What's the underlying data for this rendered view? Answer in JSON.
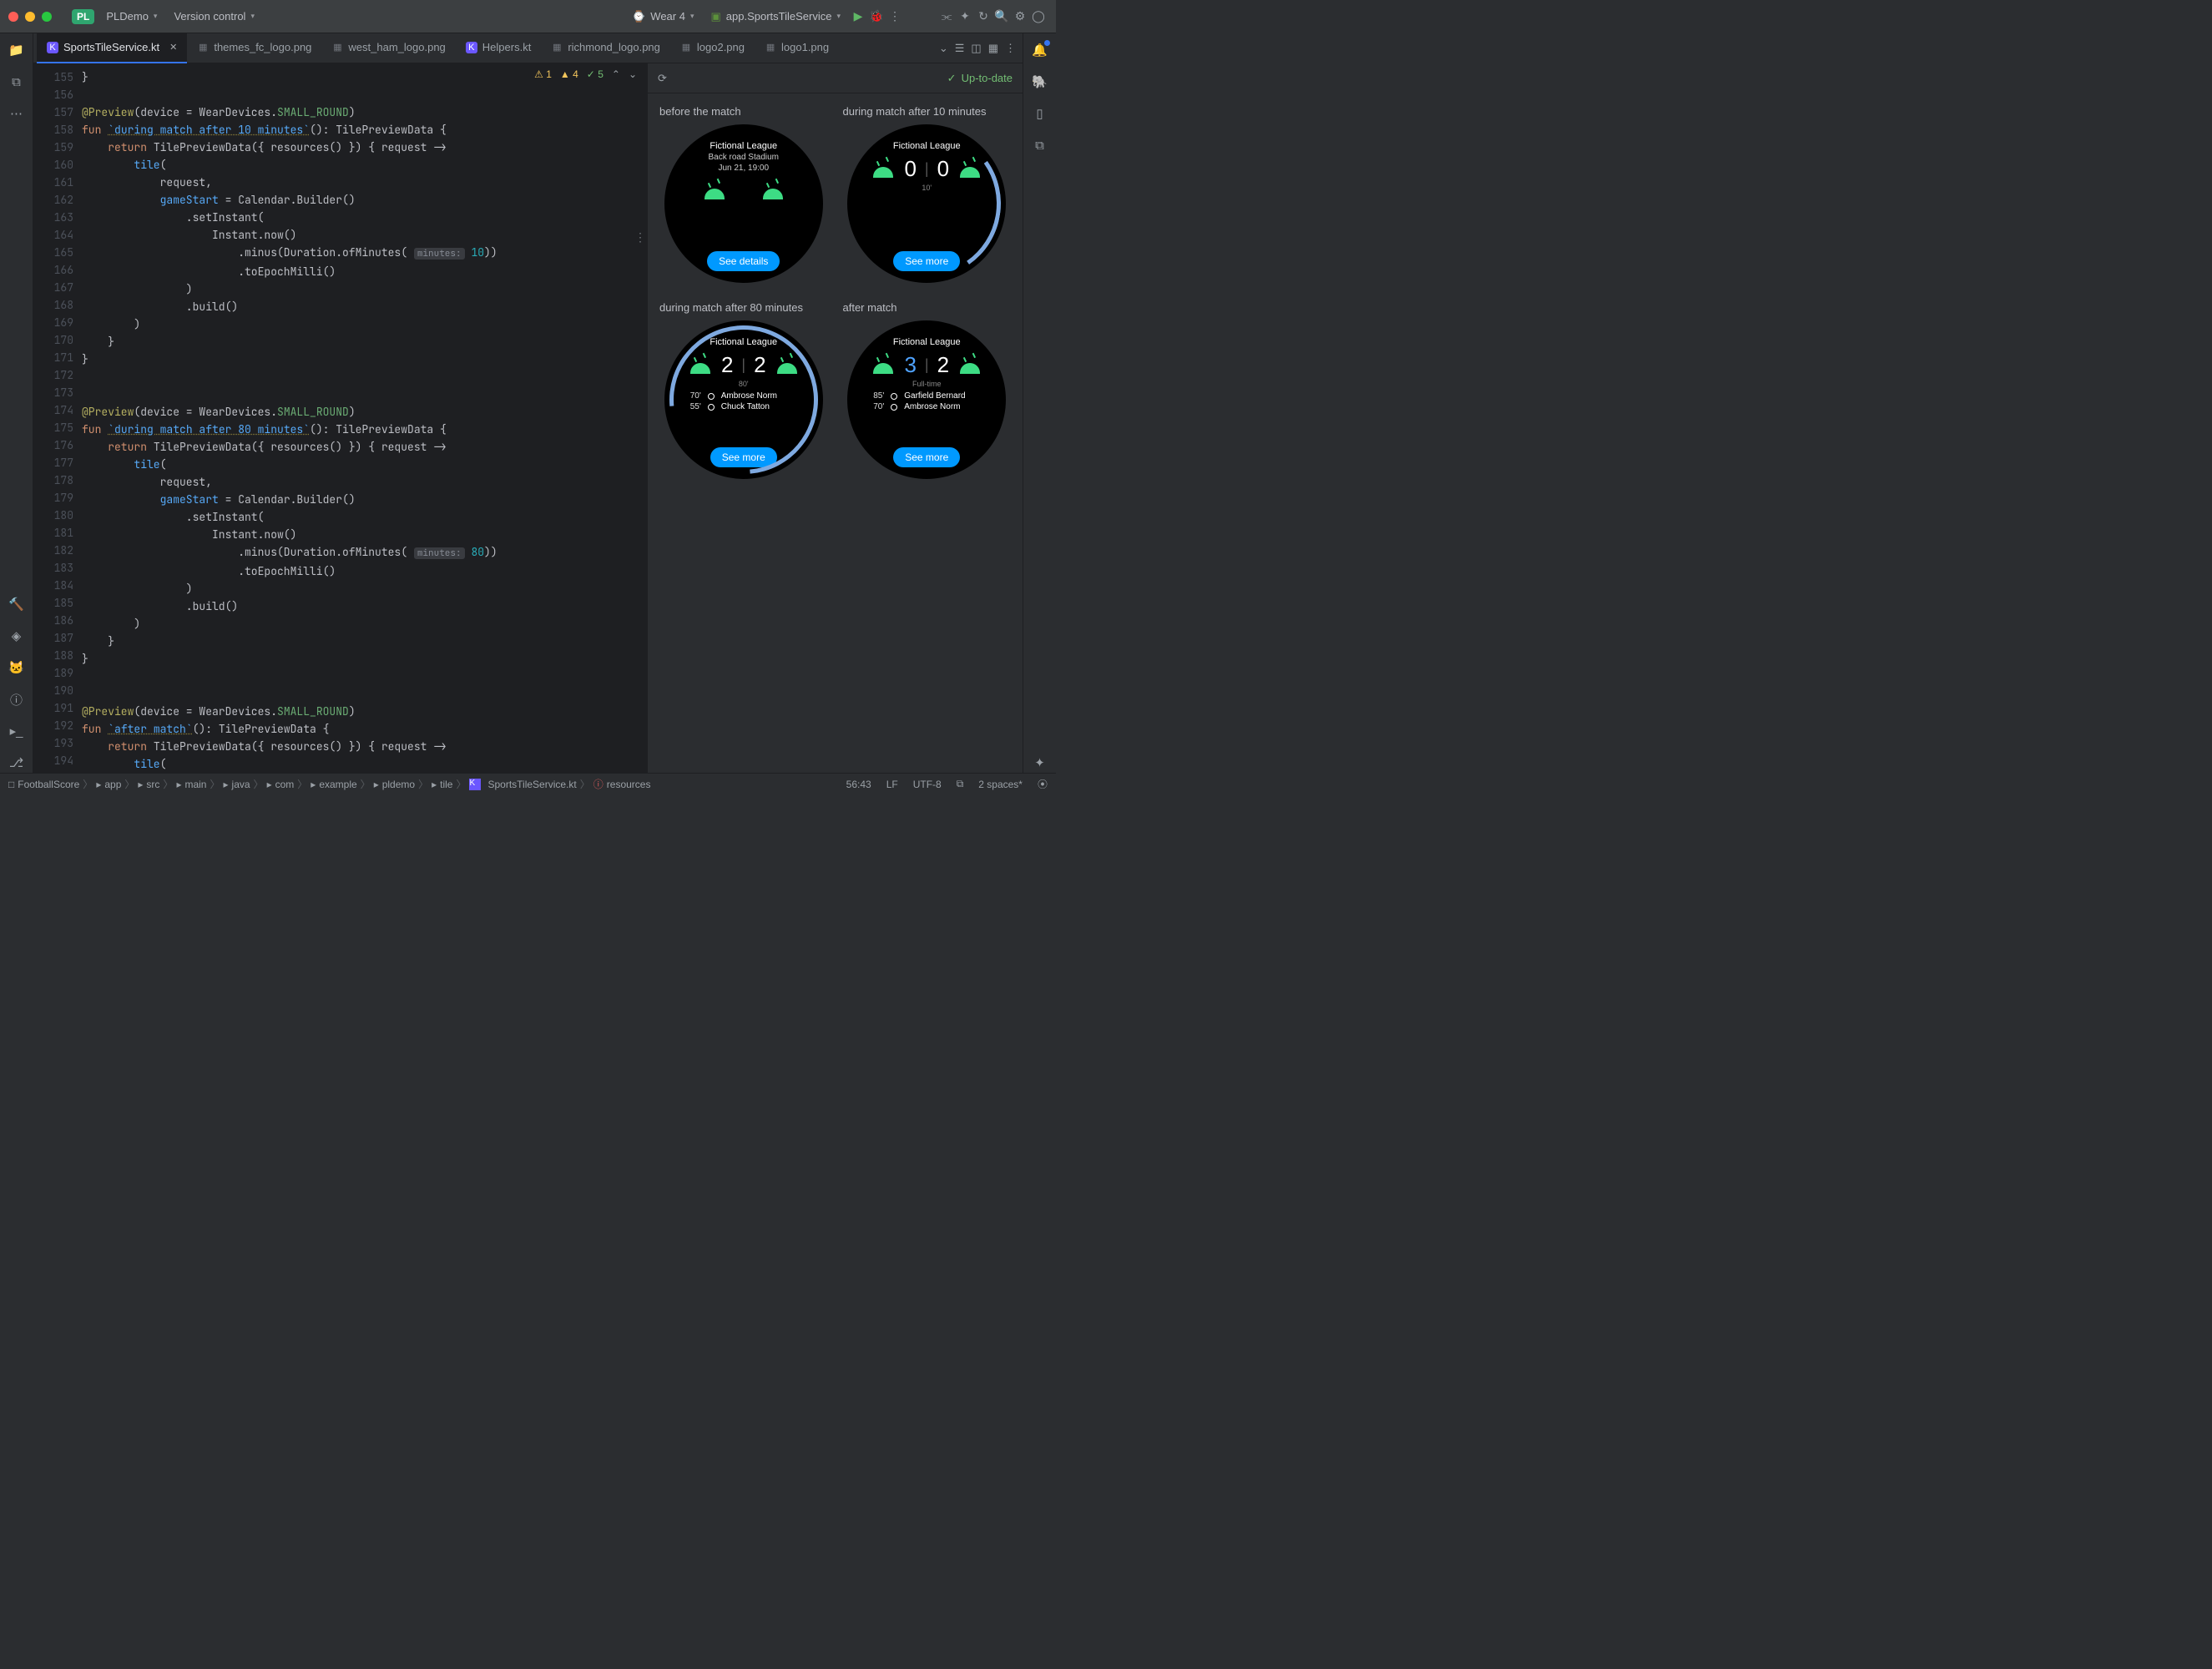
{
  "titlebar": {
    "project_badge": "PL",
    "project_name": "PLDemo",
    "menu_vcs": "Version control",
    "run_device": "Wear 4",
    "run_config": "app.SportsTileService"
  },
  "tabs": [
    {
      "label": "SportsTileService.kt",
      "type": "kt",
      "active": true,
      "closable": true
    },
    {
      "label": "themes_fc_logo.png",
      "type": "img"
    },
    {
      "label": "west_ham_logo.png",
      "type": "img"
    },
    {
      "label": "Helpers.kt",
      "type": "kt"
    },
    {
      "label": "richmond_logo.png",
      "type": "img"
    },
    {
      "label": "logo2.png",
      "type": "img"
    },
    {
      "label": "logo1.png",
      "type": "img"
    }
  ],
  "inspections": {
    "errors": "1",
    "warnings": "4",
    "weak": "5"
  },
  "gutter_start": 155,
  "gutter_end": 194,
  "code": {
    "preview_annotation": "@Preview",
    "device_param": "(device = WearDevices.",
    "device_const": "SMALL_ROUND",
    "fun_kw": "fun",
    "return_kw": "return",
    "request": "request",
    "gameStart": "gameStart",
    "hint_label": "minutes:",
    "fn1_name": "`during match after 10 minutes`",
    "fn1_num": "10",
    "fn2_name": "`during match after 80 minutes`",
    "fn2_num": "80",
    "fn3_name": "`after match`",
    "tpd": "TilePreviewData",
    "tpd_args": "({ resources() }) { request ->",
    "tile": "tile",
    "calendar": "Calendar.Builder()",
    "setInstant": ".setInstant(",
    "instant": "Instant.now()",
    "minus": ".minus(Duration.ofMinutes(",
    "toEpoch": ".toEpochMilli()",
    "build": ".build()",
    "ret_type": ": TilePreviewData {"
  },
  "preview": {
    "status": "Up-to-date",
    "league": "Fictional League",
    "tiles": [
      {
        "title": "before the match",
        "stadium": "Back road Stadium",
        "date": "Jun 21, 19:00",
        "button": "See details"
      },
      {
        "title": "during match after 10 minutes",
        "score_a": "0",
        "score_b": "0",
        "time": "10'",
        "button": "See more",
        "ring": "ring1"
      },
      {
        "title": "during match after 80 minutes",
        "score_a": "2",
        "score_b": "2",
        "time": "80'",
        "events": [
          {
            "min": "70'",
            "name": "Ambrose Norm"
          },
          {
            "min": "55'",
            "name": "Chuck Tatton"
          }
        ],
        "button": "See more",
        "ring": "ring2"
      },
      {
        "title": "after match",
        "score_a": "3",
        "score_b": "2",
        "time": "Full-time",
        "score_a_blue": true,
        "events": [
          {
            "min": "85'",
            "name": "Garfield Bernard"
          },
          {
            "min": "70'",
            "name": "Ambrose Norm"
          }
        ],
        "button": "See more"
      }
    ]
  },
  "breadcrumbs": [
    "FootballScore",
    "app",
    "src",
    "main",
    "java",
    "com",
    "example",
    "pldemo",
    "tile",
    "SportsTileService.kt",
    "resources"
  ],
  "status": {
    "pos": "56:43",
    "le": "LF",
    "enc": "UTF-8",
    "indent": "2 spaces*"
  }
}
